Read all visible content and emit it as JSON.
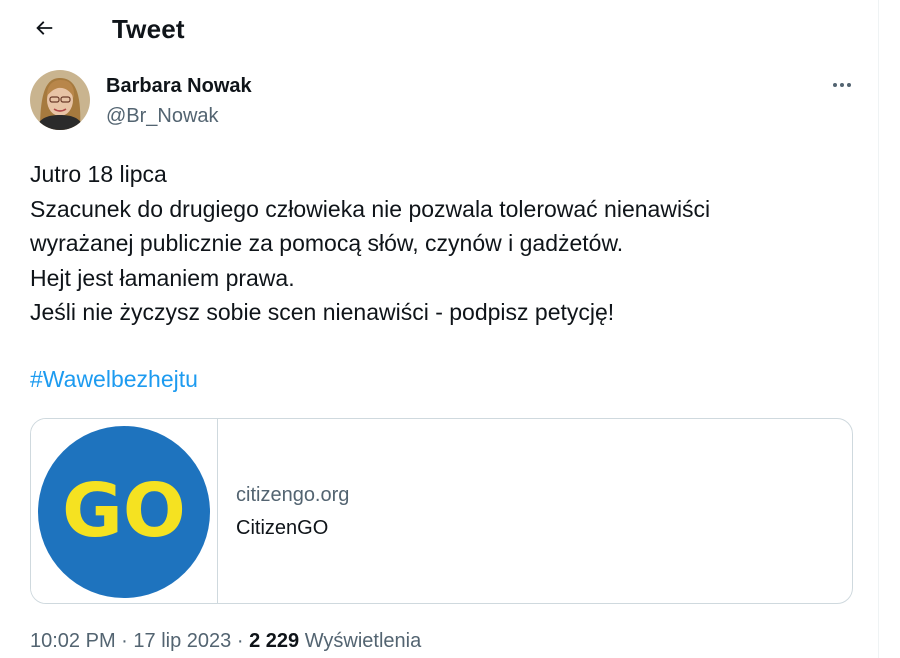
{
  "header": {
    "title": "Tweet"
  },
  "author": {
    "name": "Barbara Nowak",
    "handle": "@Br_Nowak"
  },
  "tweet": {
    "lines": [
      "Jutro 18 lipca",
      "Szacunek do drugiego człowieka nie pozwala tolerować nienawiści",
      "wyrażanej publicznie za pomocą słów, czynów i gadżetów.",
      "Hejt jest łamaniem prawa.",
      "Jeśli nie życzysz sobie scen nienawiści - podpisz petycję!"
    ],
    "hashtag": "#Wawelbezhejtu"
  },
  "card": {
    "logo_text": "GO",
    "logo_bg_color": "#1e73be",
    "logo_text_color": "#f5e221",
    "domain": "citizengo.org",
    "title": "CitizenGO"
  },
  "meta": {
    "time": "10:02 PM",
    "separator": "·",
    "date": "17 lip 2023",
    "views_count": "2 229",
    "views_label": "Wyświetlenia"
  },
  "colors": {
    "link": "#1d9bf0",
    "secondary_text": "#536471",
    "border": "#cfd9de"
  },
  "icons": {
    "back": "arrow-left-icon",
    "more": "more-horizontal-icon"
  }
}
